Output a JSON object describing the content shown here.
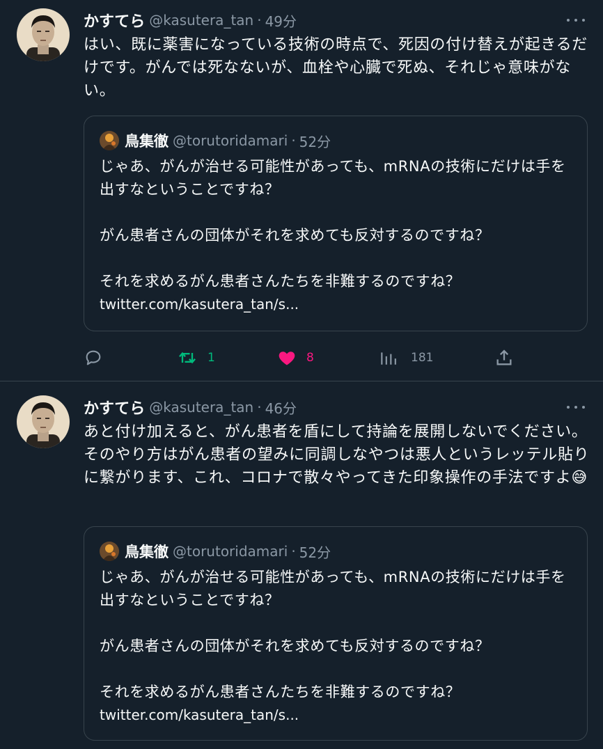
{
  "colors": {
    "background": "#15202b",
    "text": "#f7f9f9",
    "muted": "#8b98a5",
    "border": "#38444d",
    "retweet_green": "#00ba7c",
    "like_pink": "#f91880"
  },
  "tweets": [
    {
      "author": {
        "display_name": "かすてら",
        "handle": "@kasutera_tan",
        "time": "49分"
      },
      "text": "はい、既に薬害になっている技術の時点で、死因の付け替えが起きるだけです。がんでは死なないが、血栓や心臓で死ぬ、それじゃ意味がない。",
      "quote": {
        "author": {
          "display_name": "鳥集徹",
          "handle": "@torutoridamari",
          "time": "52分"
        },
        "text": "じゃあ、がんが治せる可能性があっても、mRNAの技術にだけは手を出すなということですね？\n\nがん患者さんの団体がそれを求めても反対するのですね？\n\nそれを求めるがん患者さんたちを非難するのですね？",
        "link": "twitter.com/kasutera_tan/s..."
      },
      "actions": {
        "retweets": "1",
        "likes": "8",
        "views": "181"
      }
    },
    {
      "author": {
        "display_name": "かすてら",
        "handle": "@kasutera_tan",
        "time": "46分"
      },
      "text": "あと付け加えると、がん患者を盾にして持論を展開しないでください。そのやり方はがん患者の望みに同調しなやつは悪人というレッテル貼りに繋がります、これ、コロナで散々やってきた印象操作の手法ですよ",
      "emoji": "😅",
      "quote": {
        "author": {
          "display_name": "鳥集徹",
          "handle": "@torutoridamari",
          "time": "52分"
        },
        "text": "じゃあ、がんが治せる可能性があっても、mRNAの技術にだけは手を出すなということですね？\n\nがん患者さんの団体がそれを求めても反対するのですね？\n\nそれを求めるがん患者さんたちを非難するのですね？",
        "link": "twitter.com/kasutera_tan/s..."
      }
    }
  ]
}
